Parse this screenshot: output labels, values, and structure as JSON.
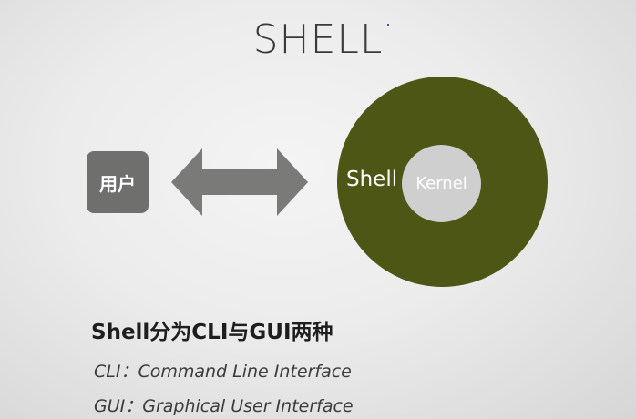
{
  "title": "SHELL",
  "diagram": {
    "user_label": "用户",
    "shell_label": "Shell",
    "kernel_label": "Kernel",
    "arrow": "bidirectional",
    "colors": {
      "user_box": "#6f706e",
      "arrow": "#7a7b79",
      "shell_circle": "#4e5616",
      "kernel_circle": "#cfcfcf"
    }
  },
  "notes": {
    "heading": "Shell分为CLI与GUI两种",
    "cli": "CLI：Command Line Interface",
    "gui": "GUI：Graphical User Interface"
  }
}
